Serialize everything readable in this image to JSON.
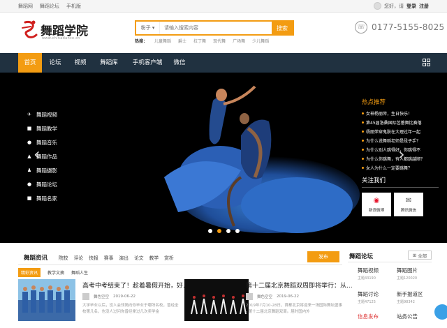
{
  "topbar": {
    "links": [
      "舞蹈网",
      "舞蹈论坛",
      "手机版"
    ],
    "greeting": "您好，请",
    "login": "登录",
    "register": "注册"
  },
  "header": {
    "logo_text": "舞蹈学院",
    "logo_url": "www.chinadance.cn",
    "search_category": "粉子 ▾",
    "search_placeholder": "请输入搜索内容",
    "search_button": "搜索",
    "hot_label": "热搜：",
    "hot_terms": [
      "儿童舞蹈",
      "爵士",
      "拉丁舞",
      "现代舞",
      "广场舞",
      "少儿舞蹈"
    ],
    "phone": "0177-5155-8025"
  },
  "nav": {
    "items": [
      "首页",
      "论坛",
      "视频",
      "舞蹈库",
      "手机客户端",
      "微信"
    ],
    "active": "首页"
  },
  "banner": {
    "menu": [
      {
        "icon": "plane-icon",
        "glyph": "✈",
        "label": "舞蹈视频"
      },
      {
        "icon": "camera-icon",
        "glyph": "■",
        "label": "舞蹈教学"
      },
      {
        "icon": "globe-icon",
        "glyph": "●",
        "label": "舞蹈音乐"
      },
      {
        "icon": "bank-icon",
        "glyph": "▲",
        "label": "舞蹈作品"
      },
      {
        "icon": "users-icon",
        "glyph": "♟",
        "label": "舞蹈摄影"
      },
      {
        "icon": "globe-icon",
        "glyph": "●",
        "label": "舞蹈论坛"
      },
      {
        "icon": "camera-icon",
        "glyph": "■",
        "label": "舞蹈名家"
      }
    ],
    "hot_title": "热点推荐",
    "hot_items": [
      "女神杨丽萍，生日快乐！",
      "第45届洛桑国际芭蕾舞比赛落",
      "杨丽萍穿鬼肤在大理过年一起",
      "为什么说舞蹈老师是段子手？",
      "为什么别人跳得好，你跳得不",
      "为什么你跳舞，有人都跳越顺？",
      "女人为什么一定要跳舞？"
    ],
    "follow_title": "关注我们",
    "social": [
      {
        "icon": "weibo-icon",
        "label": "新浪微博"
      },
      {
        "icon": "wechat-icon",
        "label": "腾讯微信"
      }
    ],
    "slides": 4,
    "active_slide": 1
  },
  "news": {
    "title": "舞蹈资讯",
    "tabs": [
      "院校",
      "评论",
      "快报",
      "赛事",
      "演出",
      "论文",
      "教学",
      "赏析"
    ],
    "publish": "发布",
    "subtabs": [
      "精彩资讯",
      "教学文摘",
      "舞蹈人生"
    ],
    "articles": [
      {
        "title": "高考中考结束了！趁着暑假开始，好...",
        "author": "舞色空空",
        "date": "2019-06-22",
        "excerpt": "大学毕业以后，没人会领简向你毕业于哪所名校，曾经全校第几名，也没人过问你曾经拿过几次奖学金"
      },
      {
        "title": "第十二届北京舞蹈双周即将举行：从...",
        "author": "舞色空空",
        "date": "2019-06-22",
        "excerpt": "2019年7月10-28日，首都北京将迎来一场国际舞坛盛事 - 第十二届北京舞蹈双周。届时国内外"
      }
    ]
  },
  "forum": {
    "title": "舞蹈论坛",
    "all": "全部",
    "boards": [
      {
        "name": "舞蹈视频",
        "sub": "主题43190"
      },
      {
        "name": "舞蹈图片",
        "sub": "主题120020"
      },
      {
        "name": "舞蹈讨论",
        "sub": "主题47125"
      },
      {
        "name": "新手报道区",
        "sub": "主题98342"
      },
      {
        "name": "信息发布",
        "sub": ""
      },
      {
        "name": "站务公告",
        "sub": ""
      }
    ]
  },
  "colors": {
    "accent": "#f39c12",
    "nav_bg": "#203140"
  }
}
